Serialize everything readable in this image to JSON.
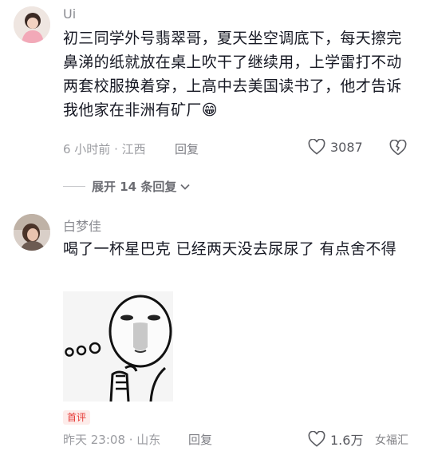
{
  "comments": [
    {
      "username": "Ui",
      "text": "初三同学外号翡翠哥，夏天坐空调底下，每天擦完鼻涕的纸就放在桌上吹干了继续用，上学雷打不动两套校服换着穿，上高中去美国读书了，他才告诉我他家在非洲有矿厂😁",
      "meta": "6 小时前 · 江西",
      "reply_label": "回复",
      "likes": "3087",
      "expand_label": "展开 14 条回复"
    },
    {
      "username": "白梦佳",
      "text": "喝了一杯星巴克 已经两天没去尿尿了 有点舍不得",
      "badge": "首评",
      "meta": "昨天 23:08 · 山东",
      "reply_label": "回复",
      "likes": "1.6万"
    }
  ],
  "watermark": "女福汇",
  "icons": {
    "like": "heart-outline-icon",
    "dislike": "broken-heart-icon",
    "expand": "chevron-down-icon"
  },
  "colors": {
    "text": "#161823",
    "secondary": "#9b9ca1",
    "badge": "#e53935"
  }
}
